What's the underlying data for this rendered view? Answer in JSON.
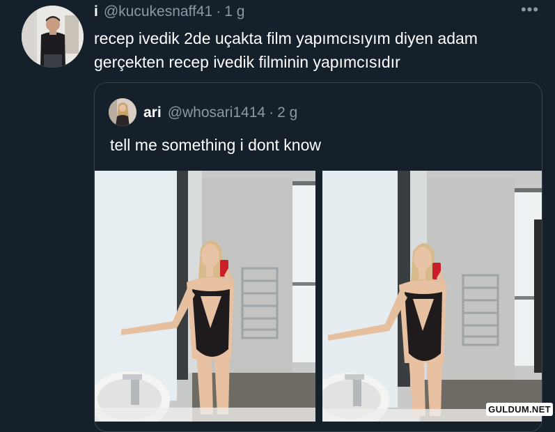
{
  "tweet": {
    "author_name": "i",
    "author_handle": "@kucukesnaff41",
    "separator": "·",
    "time": "1 g",
    "text": "recep ivedik 2de uçakta film yapımcısıyım diyen adam gerçekten recep ivedik filminin yapımcısıdır",
    "more_icon": "more-horizontal-icon"
  },
  "quoted_tweet": {
    "author_name": "ari",
    "author_handle": "@whosari1414",
    "separator": "·",
    "time": "2 g",
    "text": "tell me something i dont know",
    "photos": [
      "bathroom mirror selfie photo 1",
      "bathroom mirror selfie photo 2"
    ]
  },
  "watermark": {
    "text": "GULDUM.NET"
  }
}
